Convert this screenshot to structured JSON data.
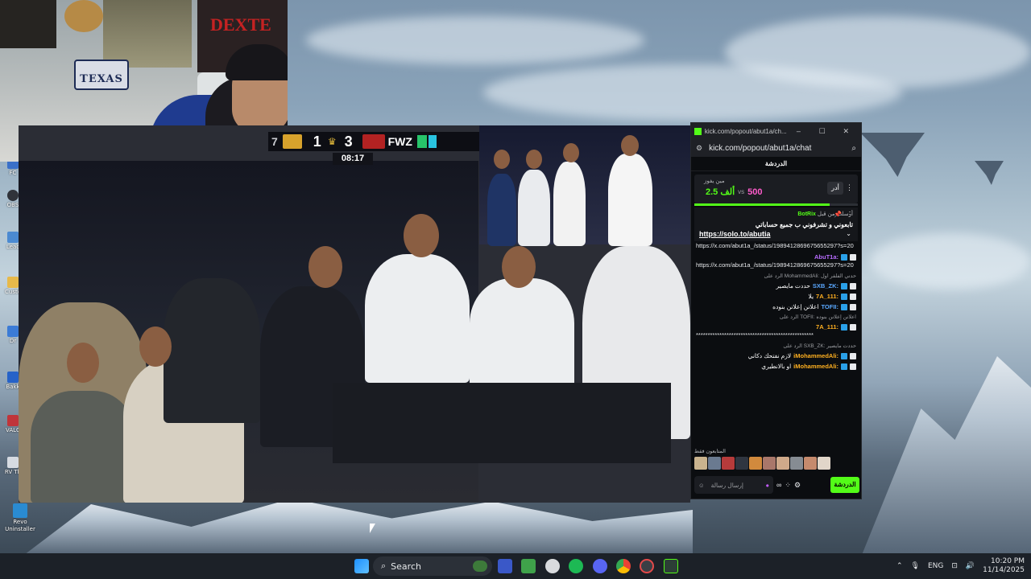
{
  "desktop": {
    "icons": [
      {
        "label": "FC",
        "color": "#3a70c9"
      },
      {
        "label": "OBS",
        "color": "#30333a"
      },
      {
        "label": "Leac",
        "color": "#4b8ad1"
      },
      {
        "label": "Custo",
        "color": "#e7b94a"
      },
      {
        "label": "Dr",
        "color": "#3b7bd6"
      },
      {
        "label": "Bakk",
        "color": "#2662c8"
      },
      {
        "label": "VALC",
        "color": "#c0353a"
      },
      {
        "label": "RV Th",
        "color": "#d6dbe2"
      },
      {
        "label": "Revo Uninstaller",
        "color": "#2a8bd2"
      }
    ]
  },
  "webcam": {
    "plate_text": "TEXAS",
    "poster_text": "DEXTE"
  },
  "stream": {
    "score": {
      "left_digit": "7",
      "left_score": "1",
      "right_score": "3",
      "right_team": "FWZ",
      "timer": "08:17"
    }
  },
  "chat": {
    "window_title": "kick.com/popout/abut1a/ch...",
    "url": "kick.com/popout/abut1a/chat",
    "header": "الدردشة",
    "prediction": {
      "label": "مين يفوز",
      "left_value": "2.5 ألف",
      "vs": "vs",
      "right_value": "500",
      "button": "أدر",
      "progress": 0.83
    },
    "pinned": {
      "by_prefix": "أرسلت من قبل",
      "by_user": "BotRix",
      "message": "تابعوني و تشرفوني ب جميع حساباتي",
      "link": "https://solo.to/abutia"
    },
    "messages": [
      {
        "type": "text",
        "text": "https://x.com/abut1a_/status/1989412869675655297?s=20"
      },
      {
        "type": "user",
        "user": "AbuT1a:",
        "color": "#b86cff",
        "text": ""
      },
      {
        "type": "text",
        "text": "https://x.com/abut1a_/status/1989412869675655297?s=20"
      },
      {
        "type": "reply",
        "text": "الرد على MohammedAli: حدني الفلفر اول"
      },
      {
        "type": "user",
        "user": "SXB_ZK:",
        "color": "#5aa8ff",
        "text": "حددت مايصير"
      },
      {
        "type": "user",
        "user": "7A_111:",
        "color": "#ffb020",
        "text": "يلا"
      },
      {
        "type": "user",
        "user": "TOFII:",
        "color": "#5aa8ff",
        "text": "اعلانن إعلانن بنوده"
      },
      {
        "type": "reply",
        "text": "الرد على TOFII: اعلانن إعلانن بنوده"
      },
      {
        "type": "user",
        "user": "7A_111:",
        "color": "#ffb020",
        "text": ""
      },
      {
        "type": "text",
        "text": "**************************************************"
      },
      {
        "type": "reply",
        "text": "الرد على SXB_ZK: حددت مايصير"
      },
      {
        "type": "user",
        "user": "iMohammedAli:",
        "color": "#ffb020",
        "text": "لازم نفتحك دكاني"
      },
      {
        "type": "user",
        "user": "iMohammedAli:",
        "color": "#ffb020",
        "text": "او بالانطيري"
      }
    ],
    "followers_label": "المتابعون فقط",
    "input_placeholder": "إرسال رسالة",
    "send_button": "الدردشة"
  },
  "taskbar": {
    "search_label": "Search",
    "language": "ENG",
    "time": "10:20 PM",
    "date": "11/14/2025"
  }
}
